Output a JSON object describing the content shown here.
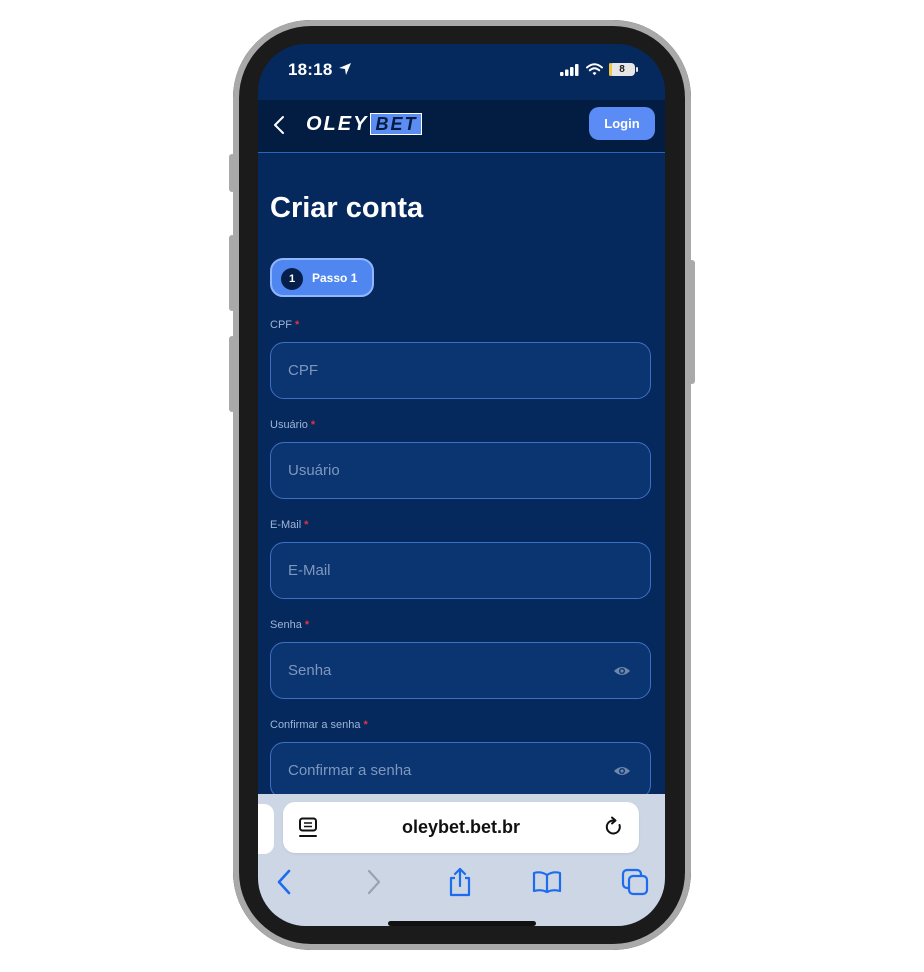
{
  "status_bar": {
    "time": "18:18",
    "battery": {
      "level": 0.08,
      "label": "8"
    },
    "icons": [
      "location-arrow-icon",
      "cellular-signal-icon",
      "wifi-icon",
      "battery-icon"
    ]
  },
  "header": {
    "logo": {
      "part1": "OLEY",
      "part2": "BET"
    },
    "login_label": "Login"
  },
  "page": {
    "title": "Criar conta",
    "step": {
      "number": "1",
      "label": "Passo 1"
    }
  },
  "form": {
    "fields": [
      {
        "label": "CPF",
        "placeholder": "CPF",
        "value": "",
        "required": "*"
      },
      {
        "label": "Usuário",
        "placeholder": "Usuário",
        "value": "",
        "required": "*"
      },
      {
        "label": "E-Mail",
        "placeholder": "E-Mail",
        "value": "",
        "required": "*"
      },
      {
        "label": "Senha",
        "placeholder": "Senha",
        "value": "",
        "required": "*"
      },
      {
        "label": "Confirmar a senha",
        "placeholder": "Confirmar a senha",
        "value": "",
        "required": "*"
      }
    ]
  },
  "browser": {
    "url": "oleybet.bet.br",
    "toolbar_icons": [
      "back-icon",
      "forward-icon",
      "share-icon",
      "bookmarks-icon",
      "tabs-icon"
    ]
  },
  "colors": {
    "background": "#05295c",
    "header": "#031c41",
    "accent": "#5b8cf5",
    "input_border": "#3e6fc4",
    "required": "#e8313f"
  }
}
